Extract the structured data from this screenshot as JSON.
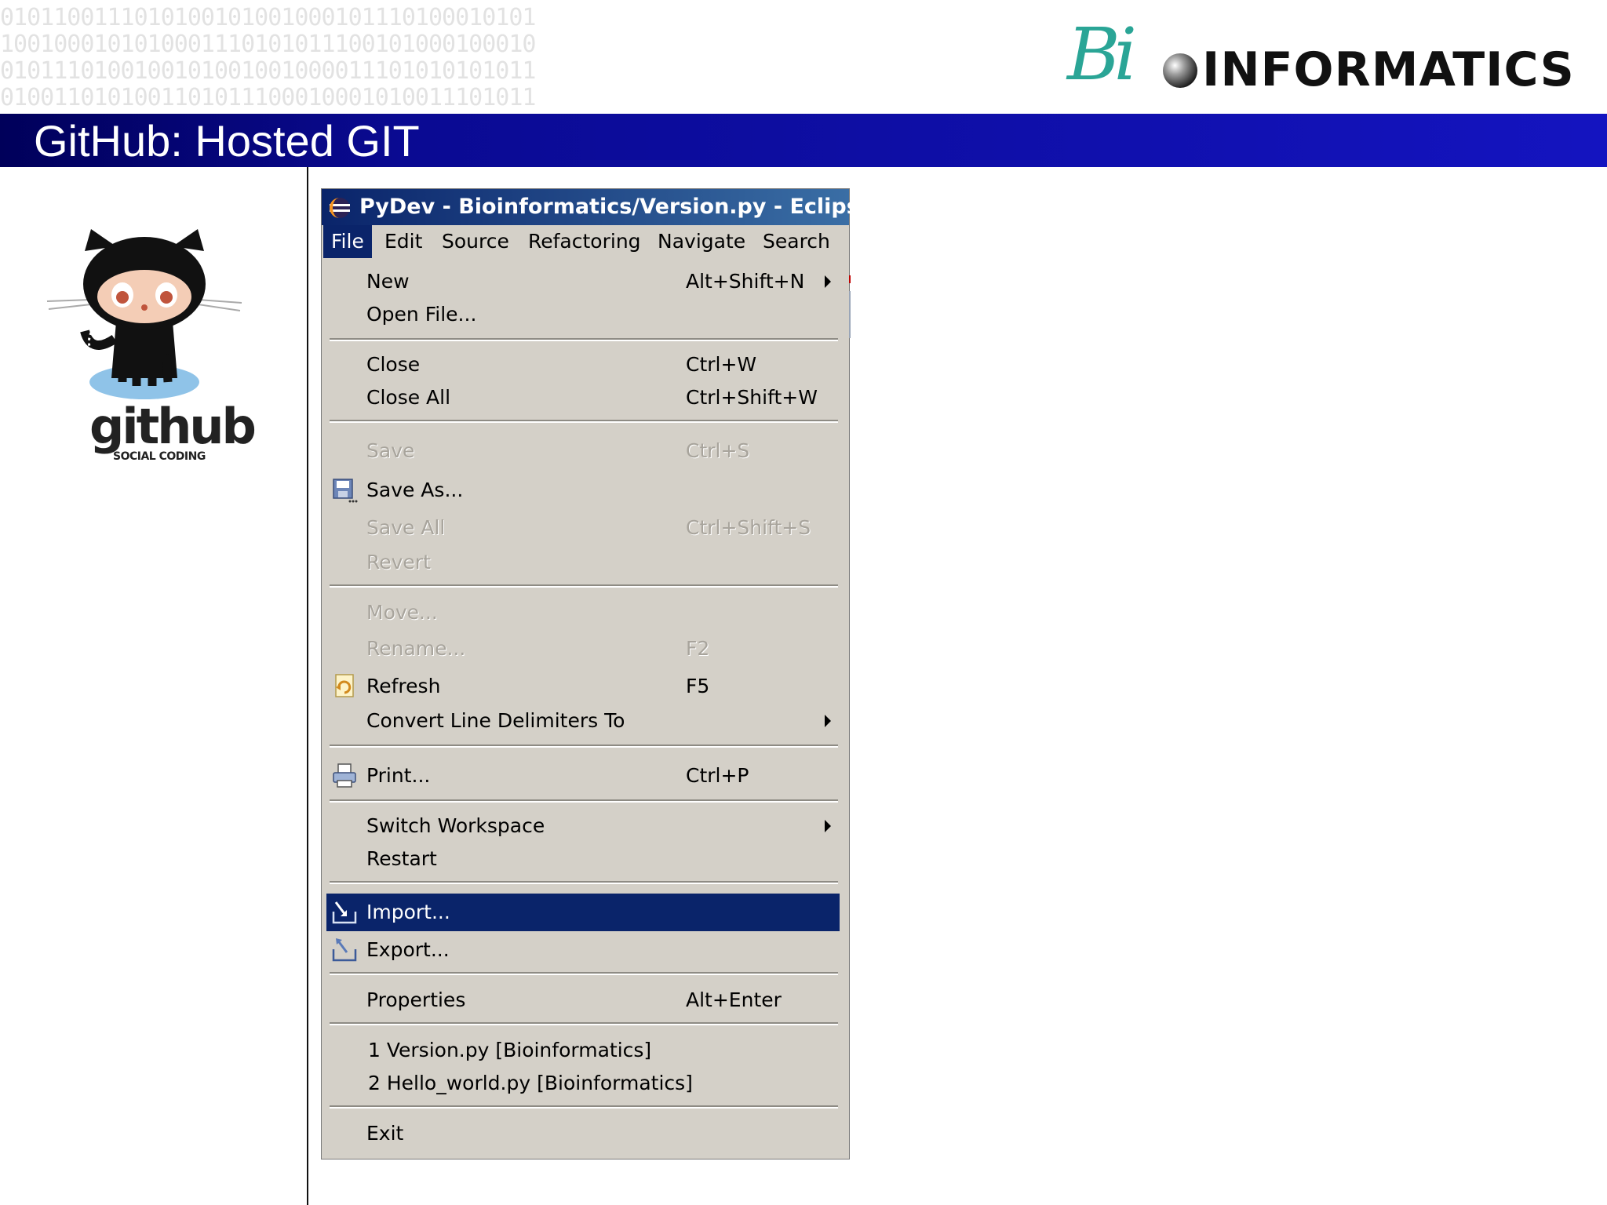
{
  "slide": {
    "title": "GitHub: Hosted GIT",
    "brand_prefix": "Bi",
    "brand_suffix": "INFORMATICS",
    "binary_text": "0101100111010100101001000101110100010101\n1001000101010001110101011100101000100010\n0101110100100101001001000011101010101011\n0100110101001101011100010001010011101011"
  },
  "github_logo": {
    "wordmark": "github",
    "tagline": "SOCIAL CODING"
  },
  "window": {
    "title": "PyDev - Bioinformatics/Version.py - Eclipse",
    "menubar": [
      "File",
      "Edit",
      "Source",
      "Refactoring",
      "Navigate",
      "Search"
    ],
    "active_menu": "File"
  },
  "file_menu": {
    "new": {
      "label": "New",
      "accel": "Alt+Shift+N"
    },
    "open_file": {
      "label": "Open File..."
    },
    "close": {
      "label": "Close",
      "accel": "Ctrl+W"
    },
    "close_all": {
      "label": "Close All",
      "accel": "Ctrl+Shift+W"
    },
    "save": {
      "label": "Save",
      "accel": "Ctrl+S",
      "enabled": false
    },
    "save_as": {
      "label": "Save As..."
    },
    "save_all": {
      "label": "Save All",
      "accel": "Ctrl+Shift+S",
      "enabled": false
    },
    "revert": {
      "label": "Revert",
      "enabled": false
    },
    "move": {
      "label": "Move...",
      "enabled": false
    },
    "rename": {
      "label": "Rename...",
      "accel": "F2",
      "enabled": false
    },
    "refresh": {
      "label": "Refresh",
      "accel": "F5"
    },
    "convert": {
      "label": "Convert Line Delimiters To"
    },
    "print": {
      "label": "Print...",
      "accel": "Ctrl+P"
    },
    "switch_workspace": {
      "label": "Switch Workspace"
    },
    "restart": {
      "label": "Restart"
    },
    "import": {
      "label": "Import...",
      "highlighted": true
    },
    "export": {
      "label": "Export..."
    },
    "properties": {
      "label": "Properties",
      "accel": "Alt+Enter"
    },
    "recent_1": {
      "label": "1 Version.py  [Bioinformatics]"
    },
    "recent_2": {
      "label": "2 Hello_world.py  [Bioinformatics]"
    },
    "exit": {
      "label": "Exit"
    }
  },
  "colors": {
    "title_bar": "#0a0a92",
    "menu_bg": "#d4d0c8",
    "highlight": "#0a246a",
    "brand_teal": "#2aa596"
  }
}
